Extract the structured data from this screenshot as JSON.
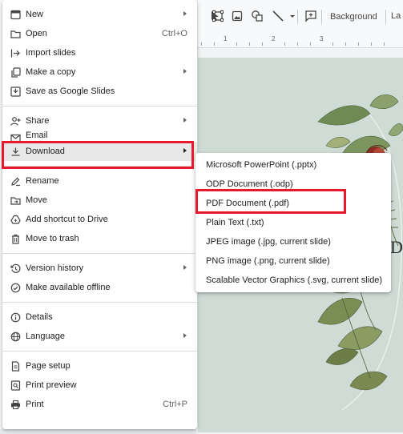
{
  "toolbar": {
    "background_label": "Background",
    "layout_trunc": "La"
  },
  "ruler": {
    "numbers": [
      "1",
      "2",
      "3"
    ]
  },
  "file_menu": {
    "groups": [
      [
        {
          "label": "New",
          "icon": "new-slide-icon",
          "shortcut": "",
          "submenu": true
        },
        {
          "label": "Open",
          "icon": "folder-icon",
          "shortcut": "Ctrl+O",
          "submenu": false
        },
        {
          "label": "Import slides",
          "icon": "import-icon",
          "shortcut": "",
          "submenu": false
        },
        {
          "label": "Make a copy",
          "icon": "copy-icon",
          "shortcut": "",
          "submenu": true
        },
        {
          "label": "Save as Google Slides",
          "icon": "save-icon",
          "shortcut": "",
          "submenu": false
        }
      ],
      [
        {
          "label": "Share",
          "icon": "share-icon",
          "shortcut": "",
          "submenu": true
        },
        {
          "label": "Email",
          "icon": "email-icon",
          "shortcut": "",
          "submenu": false
        },
        {
          "label": "Download",
          "icon": "download-icon",
          "shortcut": "",
          "submenu": true
        }
      ],
      [
        {
          "label": "Rename",
          "icon": "rename-icon",
          "shortcut": "",
          "submenu": false
        },
        {
          "label": "Move",
          "icon": "move-icon",
          "shortcut": "",
          "submenu": false
        },
        {
          "label": "Add shortcut to Drive",
          "icon": "drive-shortcut-icon",
          "shortcut": "",
          "submenu": false
        },
        {
          "label": "Move to trash",
          "icon": "trash-icon",
          "shortcut": "",
          "submenu": false
        }
      ],
      [
        {
          "label": "Version history",
          "icon": "history-icon",
          "shortcut": "",
          "submenu": true
        },
        {
          "label": "Make available offline",
          "icon": "offline-icon",
          "shortcut": "",
          "submenu": false
        }
      ],
      [
        {
          "label": "Details",
          "icon": "info-icon",
          "shortcut": "",
          "submenu": false
        },
        {
          "label": "Language",
          "icon": "globe-icon",
          "shortcut": "",
          "submenu": true
        }
      ],
      [
        {
          "label": "Page setup",
          "icon": "page-setup-icon",
          "shortcut": "",
          "submenu": false
        },
        {
          "label": "Print preview",
          "icon": "print-preview-icon",
          "shortcut": "",
          "submenu": false
        },
        {
          "label": "Print",
          "icon": "print-icon",
          "shortcut": "Ctrl+P",
          "submenu": false
        }
      ]
    ]
  },
  "download_submenu": {
    "items": [
      "Microsoft PowerPoint (.pptx)",
      "ODP Document (.odp)",
      "PDF Document (.pdf)",
      "Plain Text (.txt)",
      "JPEG image (.jpg, current slide)",
      "PNG image (.png, current slide)",
      "Scalable Vector Graphics (.svg, current slide)"
    ]
  },
  "slide": {
    "visible_letter": "D"
  },
  "colors": {
    "highlight": "#e8192c",
    "slide_bg": "#cfdcd6",
    "menu_bg": "#ffffff",
    "active_row": "#e8e8e8"
  }
}
